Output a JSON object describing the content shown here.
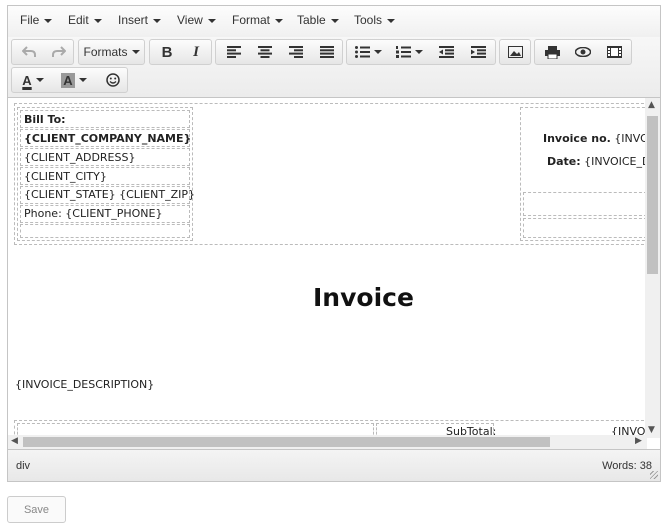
{
  "menubar": {
    "items": [
      {
        "label": "File"
      },
      {
        "label": "Edit"
      },
      {
        "label": "Insert"
      },
      {
        "label": "View"
      },
      {
        "label": "Format"
      },
      {
        "label": "Table"
      },
      {
        "label": "Tools"
      }
    ]
  },
  "toolbar": {
    "formats_label": "Formats",
    "icons": [
      "undo-icon",
      "redo-icon",
      "bold-icon",
      "italic-icon",
      "align-left-icon",
      "align-center-icon",
      "align-right-icon",
      "align-justify-icon",
      "bullet-list-icon",
      "numbered-list-icon",
      "outdent-icon",
      "indent-icon",
      "image-icon",
      "print-icon",
      "preview-icon",
      "media-icon",
      "text-color-icon",
      "background-color-icon",
      "emoticons-icon"
    ]
  },
  "content": {
    "bill_to": "Bill To:",
    "client_company": "{CLIENT_COMPANY_NAME}",
    "client_address": "{CLIENT_ADDRESS}",
    "client_city": "{CLIENT_CITY}",
    "client_state_zip": "{CLIENT_STATE} {CLIENT_ZIP}",
    "client_phone": "Phone: {CLIENT_PHONE}",
    "invoice_no_label": "Invoice no.",
    "invoice_no_value": "{INVO",
    "date_label": "Date:",
    "date_value": "{INVOICE_D",
    "title": "Invoice",
    "description": "{INVOICE_DESCRIPTION}",
    "subtotal_label": "SubTotal:",
    "subtotal_value": "{INVO"
  },
  "statusbar": {
    "path": "div",
    "words": "Words: 38"
  },
  "save_label": "Save",
  "colors": {
    "toolbar_bg": "#ececec",
    "border": "#c5c5c5",
    "scroll_thumb": "#c1c1c1"
  }
}
